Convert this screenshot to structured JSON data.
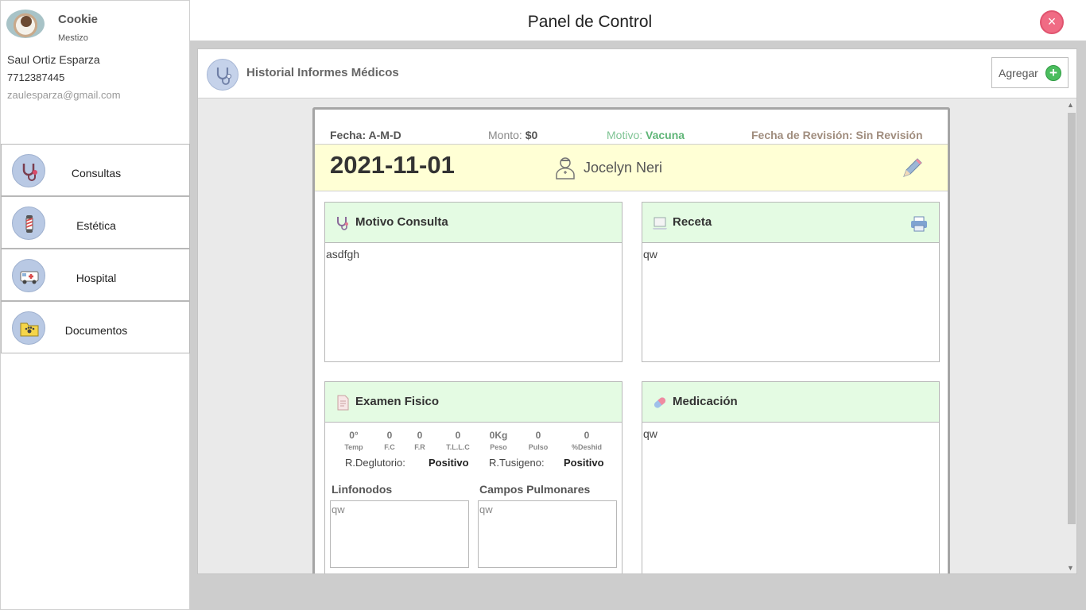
{
  "pet": {
    "name": "Cookie",
    "breed": "Mestizo"
  },
  "owner": {
    "name": "Saul Ortiz Esparza",
    "phone": "7712387445",
    "email": "zaulesparza@gmail.com"
  },
  "nav": {
    "items": [
      {
        "label": "Consultas",
        "icon": "stethoscope-icon"
      },
      {
        "label": "Estética",
        "icon": "barber-pole-icon"
      },
      {
        "label": "Hospital",
        "icon": "ambulance-icon"
      },
      {
        "label": "Documentos",
        "icon": "folder-paw-icon"
      }
    ]
  },
  "header": {
    "title": "Panel de Control",
    "close_symbol": "×"
  },
  "panel": {
    "title": "Historial Informes Médicos",
    "add_label": "Agregar",
    "add_symbol": "+"
  },
  "record": {
    "fecha_label": "Fecha: A-M-D",
    "monto_label": "Monto:",
    "monto_value": "$0",
    "motivo_label": "Motivo:",
    "motivo_value": "Vacuna",
    "revision_label": "Fecha de Revisión: Sin Revisión",
    "date": "2021-11-01",
    "doctor": "Jocelyn Neri",
    "motivo_consulta": {
      "title": "Motivo Consulta",
      "text": "asdfgh"
    },
    "receta": {
      "title": "Receta",
      "text": "qw"
    },
    "examen_fisico": {
      "title": "Examen Fisico",
      "vitals": [
        {
          "value": "0°",
          "label": "Temp"
        },
        {
          "value": "0",
          "label": "F.C"
        },
        {
          "value": "0",
          "label": "F.R"
        },
        {
          "value": "0",
          "label": "T.L.L.C"
        },
        {
          "value": "0Kg",
          "label": "Peso"
        },
        {
          "value": "0",
          "label": "Pulso"
        },
        {
          "value": "0",
          "label": "%Deshid"
        }
      ],
      "deglutorio_label": "R.Deglutorio:",
      "deglutorio_value": "Positivo",
      "tusigeno_label": "R.Tusigeno:",
      "tusigeno_value": "Positivo",
      "linfonodos_title": "Linfonodos",
      "linfonodos_text": "qw",
      "campos_title": "Campos Pulmonares",
      "campos_text": "qw"
    },
    "medicacion": {
      "title": "Medicación",
      "text": "qw"
    }
  },
  "colors": {
    "section_header": "#e4fbe3",
    "date_bar": "#ffffd5",
    "close": "#f06b84",
    "add": "#4bbd5e"
  }
}
